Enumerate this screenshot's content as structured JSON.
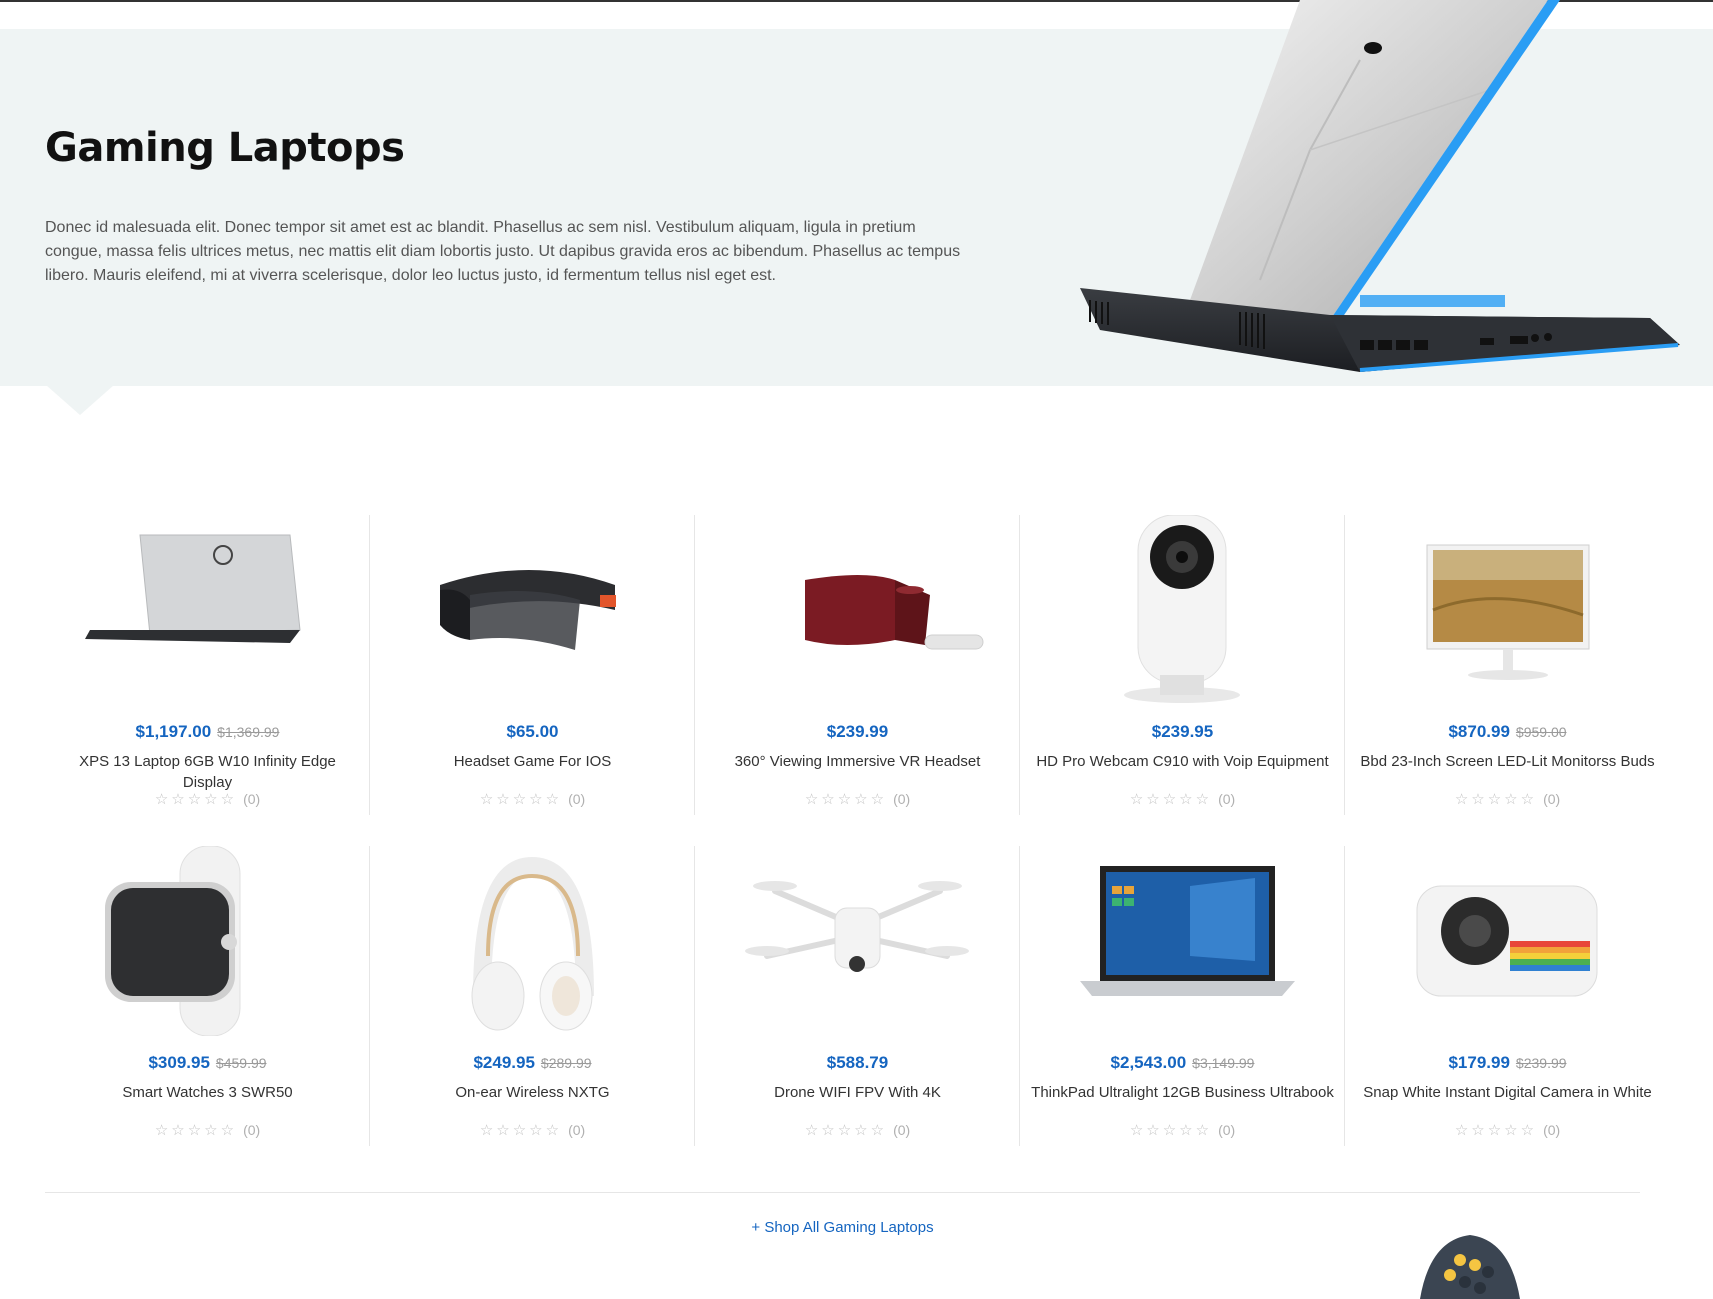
{
  "hero": {
    "title": "Gaming Laptops",
    "description": "Donec id malesuada elit. Donec tempor sit amet est ac blandit. Phasellus ac sem nisl. Vestibulum aliquam, ligula in pretium congue, massa felis ultrices metus, nec mattis elit diam lobortis justo. Ut dapibus gravida eros ac bibendum. Phasellus ac tempus libero. Mauris eleifend, mi at viverra scelerisque, dolor leo luctus justo, id fermentum tellus nisl eget est."
  },
  "products": [
    {
      "name": "XPS 13 Laptop 6GB W10 Infinity Edge Display",
      "price": "$1,197.00",
      "old_price": "$1,369.99",
      "stars": "☆☆☆☆☆",
      "rating_count": "(0)"
    },
    {
      "name": "Headset Game For IOS",
      "price": "$65.00",
      "old_price": "",
      "stars": "☆☆☆☆☆",
      "rating_count": "(0)"
    },
    {
      "name": "360° Viewing Immersive VR Headset",
      "price": "$239.99",
      "old_price": "",
      "stars": "☆☆☆☆☆",
      "rating_count": "(0)"
    },
    {
      "name": "HD Pro Webcam C910 with Voip Equipment",
      "price": "$239.95",
      "old_price": "",
      "stars": "☆☆☆☆☆",
      "rating_count": "(0)"
    },
    {
      "name": "Bbd 23-Inch Screen LED-Lit Monitorss Buds",
      "price": "$870.99",
      "old_price": "$959.00",
      "stars": "☆☆☆☆☆",
      "rating_count": "(0)"
    },
    {
      "name": "Smart Watches 3 SWR50",
      "price": "$309.95",
      "old_price": "$459.99",
      "stars": "☆☆☆☆☆",
      "rating_count": "(0)"
    },
    {
      "name": "On-ear Wireless NXTG",
      "price": "$249.95",
      "old_price": "$289.99",
      "stars": "☆☆☆☆☆",
      "rating_count": "(0)"
    },
    {
      "name": "Drone WIFI FPV With 4K",
      "price": "$588.79",
      "old_price": "",
      "stars": "☆☆☆☆☆",
      "rating_count": "(0)"
    },
    {
      "name": "ThinkPad Ultralight 12GB Business Ultrabook",
      "price": "$2,543.00",
      "old_price": "$3,149.99",
      "stars": "☆☆☆☆☆",
      "rating_count": "(0)"
    },
    {
      "name": "Snap White Instant Digital Camera in White",
      "price": "$179.99",
      "old_price": "$239.99",
      "stars": "☆☆☆☆☆",
      "rating_count": "(0)"
    }
  ],
  "footer": {
    "shop_all_label": "+ Shop All Gaming Laptops"
  },
  "colors": {
    "accent": "#1565c0",
    "hero_bg": "#eff4f4",
    "old_price": "#9a9a9a",
    "star": "#c3c3c3"
  }
}
